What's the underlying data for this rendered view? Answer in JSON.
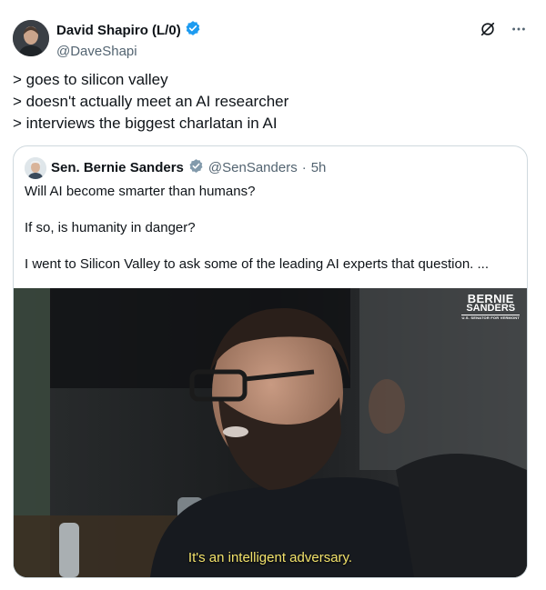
{
  "author": {
    "name": "David Shapiro (L/0)",
    "handle": "@DaveShapi",
    "verified": true,
    "badge_color": "#1d9bf0"
  },
  "actions": {
    "grok_icon": "grok-icon",
    "more_icon": "more-icon"
  },
  "tweet_lines": [
    "> goes to silicon valley",
    "> doesn't actually meet an AI researcher",
    "> interviews the biggest charlatan in AI"
  ],
  "quoted": {
    "name": "Sen. Bernie Sanders",
    "handle": "@SenSanders",
    "separator": "·",
    "time": "5h",
    "verified": true,
    "badge_color": "#829aab",
    "paragraphs": [
      "Will AI become smarter than humans?",
      "If so, is humanity in danger?",
      "I went to Silicon Valley to ask some of the leading AI experts that question. ..."
    ],
    "media": {
      "caption": "It's an intelligent adversary.",
      "brand_line1": "BERNIE",
      "brand_line2": "SANDERS",
      "brand_line3": "U.S. SENATOR FOR VERMONT"
    }
  }
}
